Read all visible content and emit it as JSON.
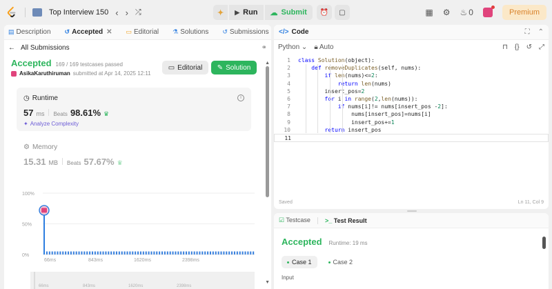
{
  "topbar": {
    "title": "Top Interview 150",
    "run_label": "Run",
    "submit_label": "Submit",
    "streak": "0",
    "premium_label": "Premium"
  },
  "left_tabs": [
    {
      "label": "Description"
    },
    {
      "label": "Accepted"
    },
    {
      "label": "Editorial"
    },
    {
      "label": "Solutions"
    },
    {
      "label": "Submissions"
    }
  ],
  "all_submissions": "All Submissions",
  "submission": {
    "status": "Accepted",
    "testcases": "169 / 169 testcases passed",
    "user": "AsikaKaruthiruman",
    "submitted": "submitted at Apr 14, 2025 12:11",
    "editorial_btn": "Editorial",
    "solution_btn": "Solution"
  },
  "runtime": {
    "label": "Runtime",
    "value": "57",
    "unit": "ms",
    "beats_label": "Beats",
    "beats": "98.61%",
    "analyze": "Analyze Complexity"
  },
  "memory": {
    "label": "Memory",
    "value": "15.31",
    "unit": "MB",
    "beats_label": "Beats",
    "beats": "57.67%"
  },
  "chart_data": {
    "type": "bar",
    "y_ticks": [
      "100%",
      "50%",
      "0%"
    ],
    "x_ticks": [
      "66ms",
      "843ms",
      "1620ms",
      "2398ms"
    ],
    "ylim": [
      0,
      100
    ],
    "highlight": {
      "x": "57ms",
      "value": 72
    },
    "values": [
      72,
      5,
      5,
      5,
      5,
      5,
      5,
      5,
      5,
      5,
      5,
      5,
      5,
      5,
      5,
      5,
      5,
      5,
      5,
      5,
      5,
      5,
      5,
      5,
      5,
      5,
      5,
      5,
      5,
      5,
      5,
      5,
      5,
      5,
      5,
      5,
      5,
      5,
      5,
      5,
      5,
      5,
      5,
      5,
      5,
      5,
      5,
      5,
      5,
      5,
      5,
      5,
      5,
      5,
      5,
      5,
      5,
      5,
      5,
      5,
      5,
      5,
      5,
      5,
      5,
      5,
      5,
      5,
      5,
      5,
      5,
      5,
      5,
      5,
      5,
      5,
      5,
      5,
      5
    ]
  },
  "mini_ticks": [
    "66ms",
    "843ms",
    "1620ms",
    "2398ms"
  ],
  "code_panel": {
    "title": "Code",
    "language": "Python",
    "auto": "Auto",
    "saved": "Saved",
    "position": "Ln 11, Col 9"
  },
  "code_lines": [
    {
      "n": "1",
      "t": "class Solution(object):"
    },
    {
      "n": "2",
      "t": "    def removeDuplicates(self, nums):"
    },
    {
      "n": "3",
      "t": "        if len(nums)<=2:"
    },
    {
      "n": "4",
      "t": "            return len(nums)"
    },
    {
      "n": "5",
      "t": "        insert_pos=2"
    },
    {
      "n": "6",
      "t": "        for i in range(2,len(nums)):"
    },
    {
      "n": "7",
      "t": "            if nums[i]!= nums[insert_pos -2]:"
    },
    {
      "n": "8",
      "t": "                nums[insert_pos]=nums[i]"
    },
    {
      "n": "9",
      "t": "                insert_pos+=1"
    },
    {
      "n": "10",
      "t": "        return insert_pos"
    },
    {
      "n": "11",
      "t": ""
    }
  ],
  "result_panel": {
    "tab_testcase": "Testcase",
    "tab_result": "Test Result",
    "status": "Accepted",
    "runtime": "Runtime: 19 ms",
    "case1": "Case 1",
    "case2": "Case 2",
    "input_label": "Input"
  }
}
